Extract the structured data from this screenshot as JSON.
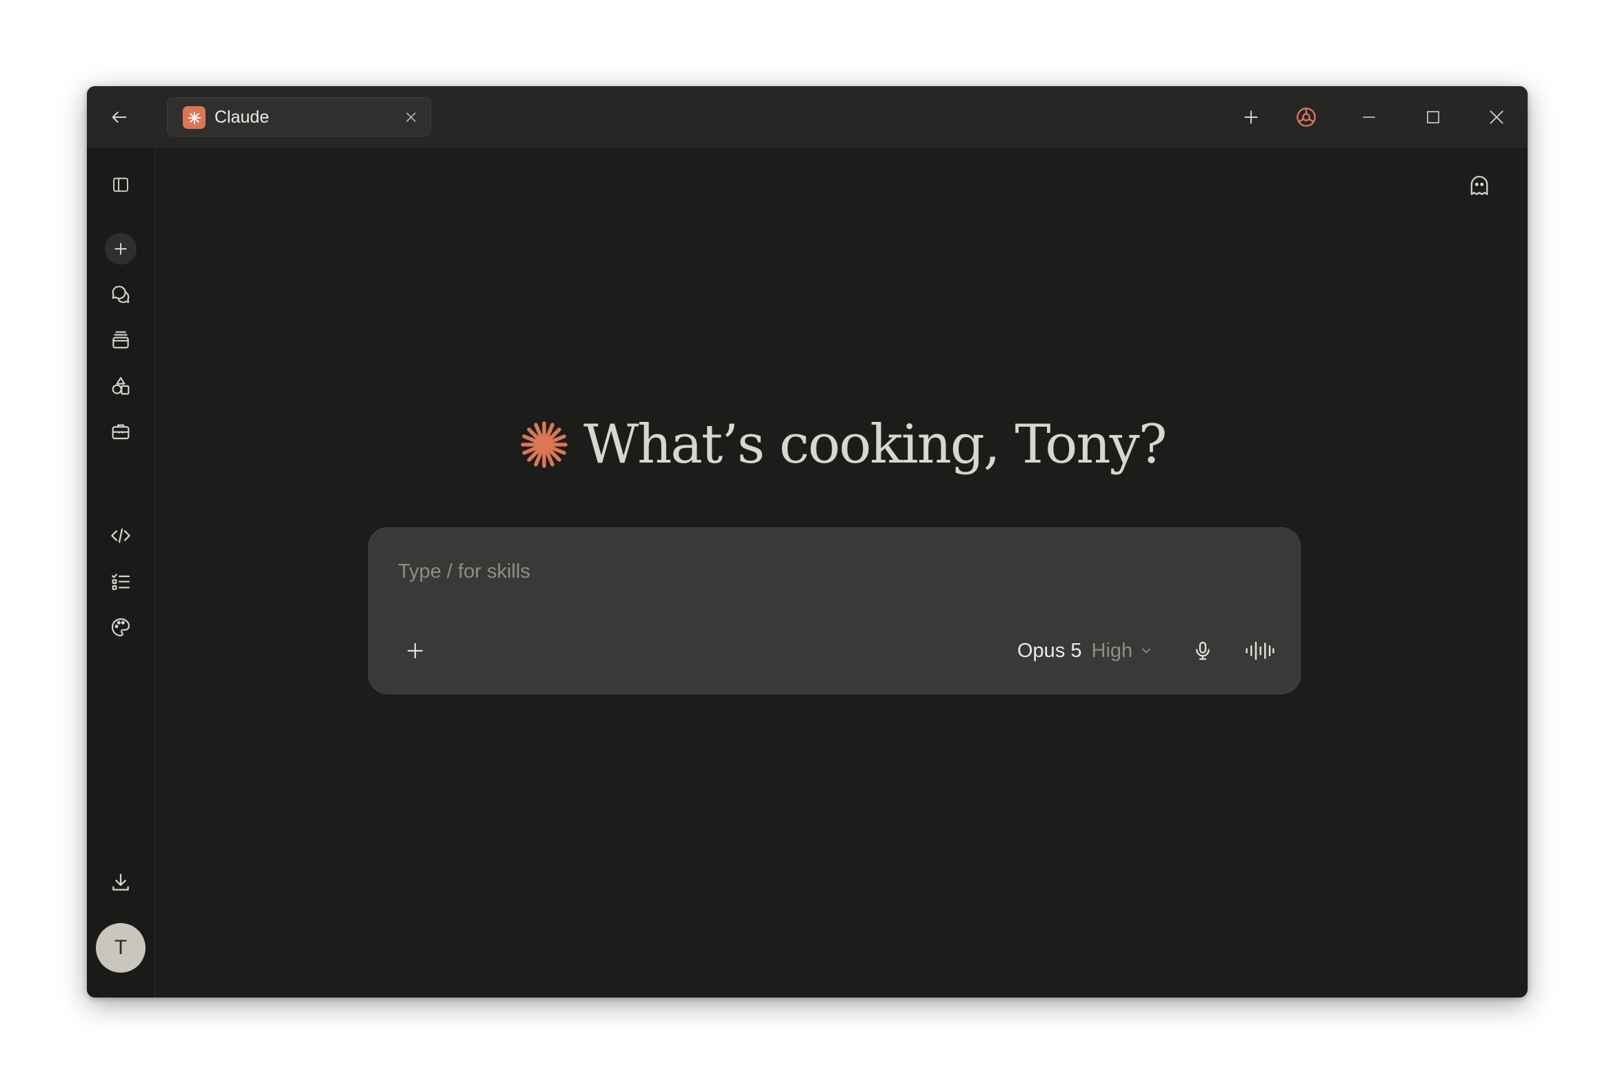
{
  "tab": {
    "title": "Claude"
  },
  "main": {
    "greeting": "What’s cooking, Tony?"
  },
  "composer": {
    "placeholder": "Type / for skills",
    "model_name": "Opus 5",
    "model_effort": "High"
  },
  "user": {
    "initial": "T"
  },
  "colors": {
    "accent": "#d97757",
    "window_bg": "#1c1c1b",
    "titlebar_bg": "#262625",
    "composer_bg": "#393937"
  },
  "icons": {
    "titlebar": [
      "back-arrow-icon",
      "close-tab-icon",
      "new-tab-icon",
      "extension-icon",
      "minimize-icon",
      "maximize-icon",
      "close-window-icon"
    ],
    "sidebar": [
      "sidebar-toggle-icon",
      "plus-icon",
      "chats-icon",
      "projects-icon",
      "artifacts-icon",
      "briefcase-icon",
      "code-icon",
      "tasks-icon",
      "palette-icon",
      "download-icon"
    ],
    "main": [
      "ghost-icon",
      "claude-spark-icon",
      "attach-plus-icon",
      "chevron-down-icon",
      "microphone-icon",
      "voice-waveform-icon"
    ]
  }
}
